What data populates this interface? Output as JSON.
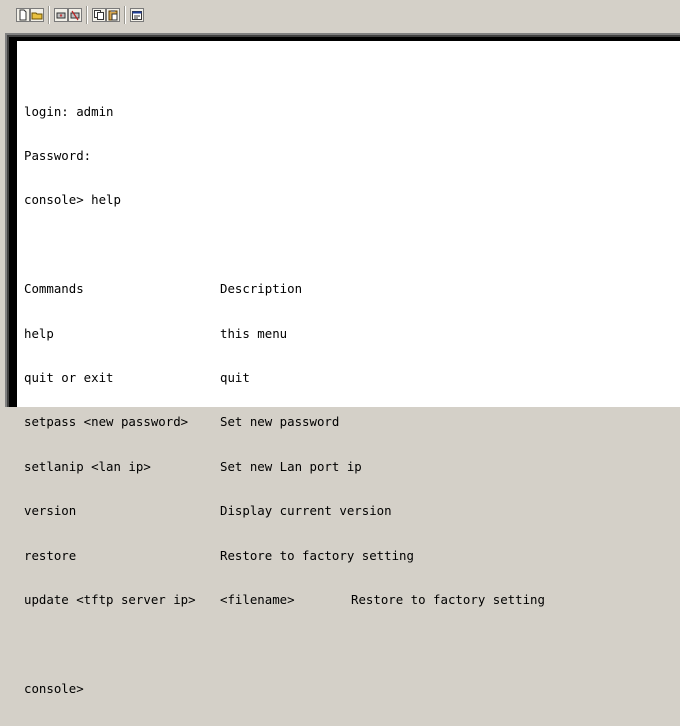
{
  "toolbar": {
    "buttons": [
      {
        "name": "new-icon"
      },
      {
        "name": "open-icon"
      },
      {
        "name": "connect-icon"
      },
      {
        "name": "disconnect-icon"
      },
      {
        "name": "copy-icon"
      },
      {
        "name": "paste-icon"
      },
      {
        "name": "properties-icon"
      }
    ]
  },
  "terminal": {
    "login_line": "login: admin",
    "password_line": "Password:",
    "command_line": "console> help",
    "header": {
      "command": "Commands",
      "description": "Description"
    },
    "commands": [
      {
        "command": "help",
        "description": "this menu"
      },
      {
        "command": "quit or exit",
        "description": "quit"
      },
      {
        "command": "setpass <new password>",
        "description": "Set new password"
      },
      {
        "command": "setlanip <lan ip>",
        "description": "Set new Lan port ip"
      },
      {
        "command": "version",
        "description": "Display current version"
      },
      {
        "command": "restore",
        "description": "Restore to factory setting"
      }
    ],
    "update": {
      "command": "update <tftp server ip>",
      "argument": "<filename>",
      "description": "Restore to factory setting"
    },
    "prompt": "console>"
  },
  "colors": {
    "window_bg": "#d4d0c8",
    "terminal_bg": "#ffffff",
    "terminal_text": "#000000"
  }
}
